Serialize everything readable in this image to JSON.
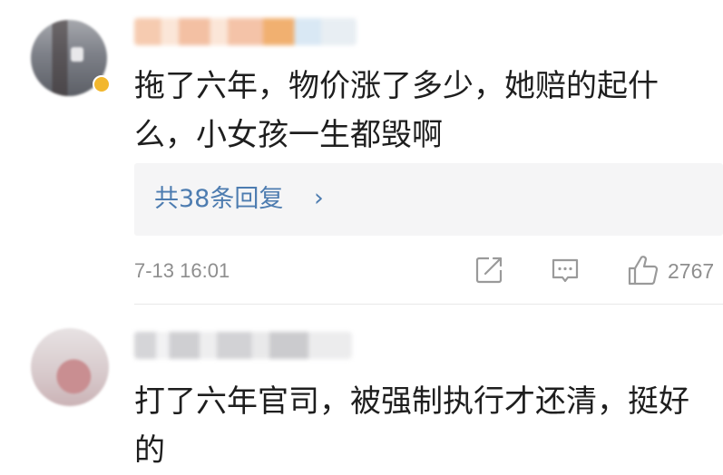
{
  "comments": [
    {
      "text": "拖了六年，物价涨了多少，她赔的起什么，小女孩一生都毁啊",
      "reply_link": "共38条回复",
      "reply_chevron": "›",
      "timestamp": "7-13 16:01",
      "like_count": "2767"
    },
    {
      "text": "打了六年官司，被强制执行才还清，挺好的"
    }
  ],
  "colors": {
    "link": "#4d7cb0",
    "meta_gray": "#8e8e8e",
    "reply_bg": "#f5f5f6",
    "badge": "#f2b72e"
  },
  "icons": {
    "share": "share-icon",
    "comment": "comment-icon",
    "like": "thumbs-up-icon",
    "chevron": "chevron-right-icon",
    "badge": "verified-badge-icon"
  }
}
